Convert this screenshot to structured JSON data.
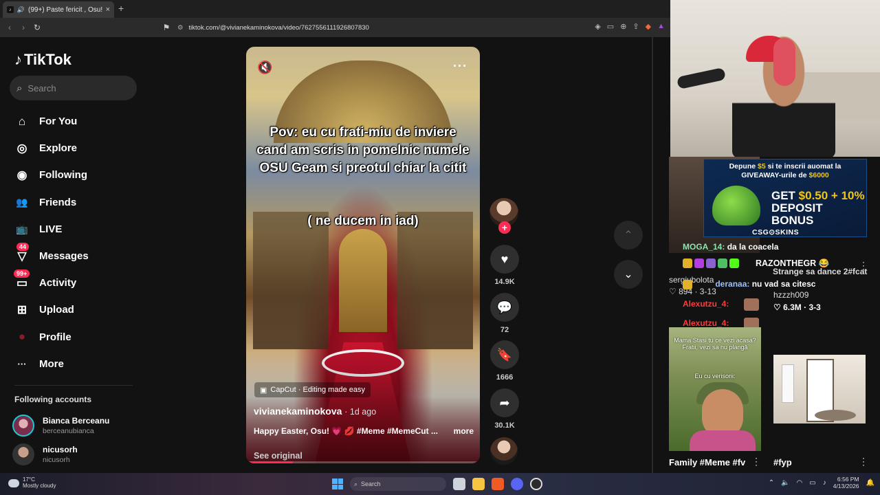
{
  "browser": {
    "tab_title": "(99+) Paste fericit , Osu! 💗 💋",
    "new_tab": "+",
    "url": "tiktok.com/@vivianekaminokova/video/7627556111926807830"
  },
  "tiktok": {
    "logo": "TikTok",
    "search_placeholder": "Search",
    "menu": [
      {
        "label": "For You",
        "icon": "⌂"
      },
      {
        "label": "Explore",
        "icon": "◎"
      },
      {
        "label": "Following",
        "icon": "◉"
      },
      {
        "label": "Friends",
        "icon": "👥"
      },
      {
        "label": "LIVE",
        "icon": "📺"
      },
      {
        "label": "Messages",
        "icon": "▽",
        "badge": "44"
      },
      {
        "label": "Activity",
        "icon": "▭",
        "badge": "99+"
      },
      {
        "label": "Upload",
        "icon": "⊞"
      },
      {
        "label": "Profile",
        "icon": "●"
      },
      {
        "label": "More",
        "icon": "···"
      }
    ],
    "following_title": "Following accounts",
    "following": [
      {
        "name": "Bianca Berceanu",
        "handle": "berceanubianca"
      },
      {
        "name": "nicusorh",
        "handle": "nicusorh"
      }
    ]
  },
  "video": {
    "caption_main": "Pov: eu cu frati-miu de inviere cand am scris in pomelnic numele OSU Geam si preotul chiar la citit",
    "caption_sub": "( ne ducem in iad)",
    "capcut": "CapCut · Editing made easy",
    "author": "vivianekaminokova",
    "posted": "· 1d ago",
    "description": "Happy Easter, Osu! 💗 💋 #Meme #MemeCut ...",
    "more": "more",
    "see_original": "See original",
    "progress": 0.2,
    "likes": "14.9K",
    "comments": "72",
    "saves": "1666",
    "shares": "30.1K"
  },
  "stream": {
    "ad_line1_a": "Depune ",
    "ad_line1_b": "$5",
    "ad_line1_c": " si te inscrii auomat la",
    "ad_line2_a": "GIVEAWAY-urile de ",
    "ad_line2_b": "$6000",
    "ad_big1": "GET ",
    "ad_big2": "$0.50 + 10%",
    "ad_big3": "DEPOSIT BONUS",
    "ad_brand": "CSG⊙SKINS",
    "chat": [
      {
        "user": "MOGA_14:",
        "msg": "da la coacela"
      },
      {
        "user": "RAZONTHEGR",
        "msg": "😂"
      },
      {
        "user": "deranaa:",
        "msg": "nu vad sa citesc"
      },
      {
        "user": "Alexutzu_4:",
        "msg": ""
      },
      {
        "user": "Alexutzu_4:",
        "msg": ""
      }
    ],
    "under_text": "Strange sa dance 2#fcat",
    "feed_left_user": "sergiubolota",
    "feed_left_likes": "894",
    "feed_left_date": "3-13",
    "feed_right_user": "hzzzh009",
    "feed_right_likes": "6.3M",
    "feed_right_date": "3-3",
    "thumb2_cap1": "Mama Stasi tu ce vezi acasa? Fratii, vezi sa nu plangă",
    "thumb2_cap2": "Eu cu verisorii:",
    "thumb2_title": "Family #Meme #fv",
    "thumb3_title": "#fyp"
  },
  "taskbar": {
    "temp": "17°C",
    "weather": "Mostly cloudy",
    "search": "Search",
    "time": "6:56 PM",
    "date": "4/13/2026"
  }
}
